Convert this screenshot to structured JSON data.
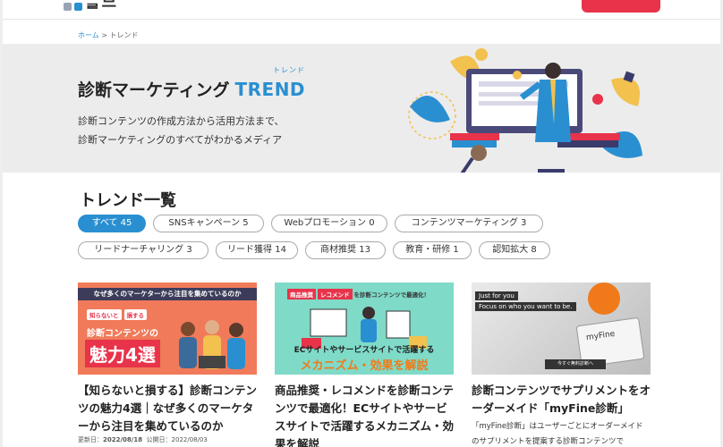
{
  "header": {
    "logo_text": "ᆯ므"
  },
  "breadcrumb": {
    "home": "ホーム",
    "separator": " > ",
    "current": "トレンド"
  },
  "hero": {
    "title_jp": "診断マーケティング",
    "title_en": "TREND",
    "ruby": "トレンド",
    "desc_line1": "診断コンテンツの作成方法から活用方法まで、",
    "desc_line2": "診断マーケティングのすべてがわかるメディア"
  },
  "section": {
    "title": "トレンド一覧"
  },
  "tags": [
    {
      "label": "すべて 45",
      "active": true
    },
    {
      "label": "SNSキャンペーン 5",
      "active": false
    },
    {
      "label": "Webプロモーション 0",
      "active": false
    },
    {
      "label": "コンテンツマーケティング 3",
      "active": false
    },
    {
      "label": "リードナーチャリング 3",
      "active": false
    },
    {
      "label": "リード獲得 14",
      "active": false
    },
    {
      "label": "商材推奨 13",
      "active": false
    },
    {
      "label": "教育・研修 1",
      "active": false
    },
    {
      "label": "認知拡大 8",
      "active": false
    }
  ],
  "cards": [
    {
      "thumb_banner": "なぜ多くのマーケターから注目を集めているのか",
      "thumb_badge1": "知らないと",
      "thumb_badge2": "損する",
      "thumb_line": "診断コンテンツの",
      "thumb_big": "魅力4選",
      "title": "【知らないと損する】診断コンテンツの魅力4選｜なぜ多くのマーケターから注目を集めているのか",
      "updated_label": "更新日：",
      "updated": "2022/08/18",
      "published_label": "公開日：",
      "published": "2022/08/03"
    },
    {
      "thumb_tag1": "商品推奨",
      "thumb_tag2": "レコメンド",
      "thumb_tagline": "を診断コンテンツで最適化！",
      "thumb_line1": "ECサイトやサービスサイトで活躍する",
      "thumb_line2": "メカニズム・効果を解説",
      "title": "商品推奨・レコメンドを診断コンテンツで最適化！ECサイトやサービスサイトで活躍するメカニズム・効果を解説"
    },
    {
      "thumb_line1": "Just for you",
      "thumb_line2": "Focus on who you want to be.",
      "thumb_box": "myFine",
      "thumb_button": "今すぐ無料診断へ",
      "title": "診断コンテンツでサプリメントをオーダーメイド「myFine診断」",
      "desc": "「myFine診断」はユーザーごとにオーダーメイドのサプリメントを提案する診断コンテンツで"
    }
  ],
  "colors": {
    "accent": "#2a8fd1",
    "cta": "#e8334a",
    "hero_bg": "#ececec"
  }
}
